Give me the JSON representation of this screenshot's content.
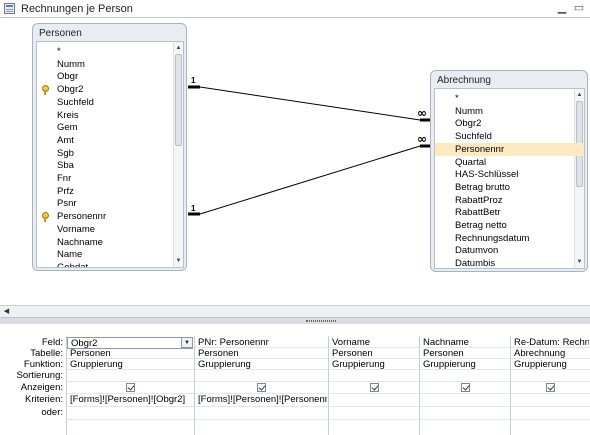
{
  "window": {
    "title": "Rechnungen je Person",
    "controls": [
      "minimize",
      "maximize"
    ]
  },
  "tables": {
    "personen": {
      "name": "Personen",
      "fields": [
        "*",
        "Numm",
        "Obgr",
        "Obgr2",
        "Suchfeld",
        "Kreis",
        "Gem",
        "Amt",
        "Sgb",
        "Sba",
        "Fnr",
        "Prfz",
        "Psnr",
        "Personennr",
        "Vorname",
        "Nachname",
        "Name",
        "Gebdat"
      ],
      "key_fields": [
        "Obgr2",
        "Personennr"
      ]
    },
    "abrechnung": {
      "name": "Abrechnung",
      "fields": [
        "*",
        "Numm",
        "Obgr2",
        "Suchfeld",
        "Personennr",
        "Quartal",
        "HAS-Schlüssel",
        "Betrag brutto",
        "RabattProz",
        "RabattBetr",
        "Betrag netto",
        "Rechnungsdatum",
        "Datumvon",
        "Datumbis"
      ],
      "selected_field": "Personennr"
    }
  },
  "relations": [
    {
      "from": "Personen.Obgr2",
      "to": "Abrechnung.Obgr2",
      "one_label": "1",
      "many_label": "∞"
    },
    {
      "from": "Personen.Personennr",
      "to": "Abrechnung.Personennr",
      "one_label": "1",
      "many_label": "∞"
    }
  ],
  "qbe": {
    "row_labels": [
      "Feld:",
      "Tabelle:",
      "Funktion:",
      "Sortierung:",
      "Anzeigen:",
      "Kriterien:",
      "oder:"
    ],
    "columns": [
      {
        "feld": "Obgr2",
        "tabelle": "Personen",
        "funktion": "Gruppierung",
        "sortierung": "",
        "anzeigen": true,
        "kriterien": "[Forms]![Personen]![Obgr2]",
        "oder": ""
      },
      {
        "feld": "PNr: Personennr",
        "tabelle": "Personen",
        "funktion": "Gruppierung",
        "sortierung": "",
        "anzeigen": true,
        "kriterien": "[Forms]![Personen]![Personennr]",
        "oder": ""
      },
      {
        "feld": "Vorname",
        "tabelle": "Personen",
        "funktion": "Gruppierung",
        "sortierung": "",
        "anzeigen": true,
        "kriterien": "",
        "oder": ""
      },
      {
        "feld": "Nachname",
        "tabelle": "Personen",
        "funktion": "Gruppierung",
        "sortierung": "",
        "anzeigen": true,
        "kriterien": "",
        "oder": ""
      },
      {
        "feld": "Re-Datum: Rechnu",
        "tabelle": "Abrechnung",
        "funktion": "Gruppierung",
        "sortierung": "",
        "anzeigen": true,
        "kriterien": "",
        "oder": ""
      }
    ]
  },
  "icons": {
    "key": "primary-key-icon",
    "dropdown": "dropdown-arrow-icon",
    "scroll_up": "scroll-up-arrow-icon",
    "scroll_down": "scroll-down-arrow-icon",
    "scroll_left": "scroll-left-arrow-icon",
    "checkbox": "checkbox-checked-icon"
  }
}
